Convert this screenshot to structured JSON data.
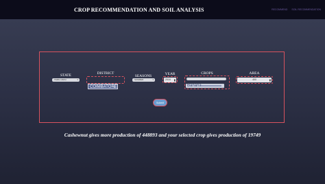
{
  "header": {
    "title": "CROP RECOMMENDATION AND SOIL ANALYSIS",
    "nav_links": [
      "RECOMMEND",
      "SOIL RECOMMENDATION"
    ]
  },
  "form": {
    "labels": {
      "state": "STATE",
      "district": "DISTRICT",
      "seasons": "SEASONS",
      "year": "YEAR",
      "crops": "CROPS",
      "area": "AREA"
    },
    "state_value": "TAMIL NADU",
    "district_value": "COIMBATORE",
    "season_value": "SUMMER",
    "year_value": "2016",
    "crops_value": "Banana",
    "area_value": "400",
    "submit_label": "Submit"
  },
  "result": {
    "text": "Cashewnut gives more production of 448893 and your selected crop gives production of 19749"
  },
  "colors": {
    "accent": "#d9535f",
    "navbar": "#0c0c1a",
    "button": "#6a9dd0"
  }
}
